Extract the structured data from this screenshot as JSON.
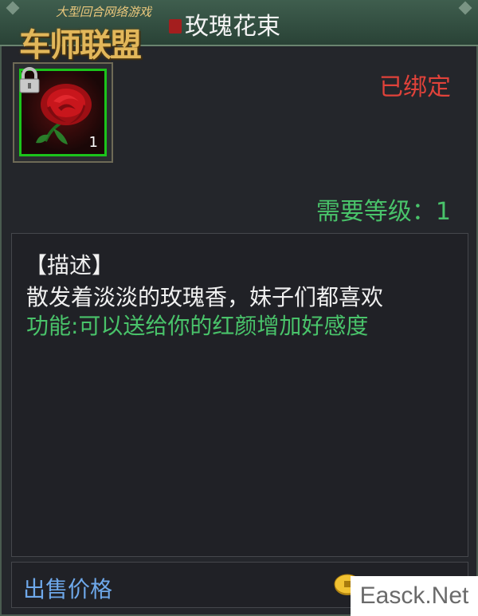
{
  "logo": {
    "tagline": "大型回合网络游戏",
    "name": "车师联盟"
  },
  "item": {
    "name": "玫瑰花束",
    "quantity": "1",
    "status": "已绑定",
    "level_requirement": "需要等级：1",
    "icon": "rose-icon",
    "locked_icon": "lock-icon"
  },
  "description": {
    "heading": "【描述】",
    "text": "散发着淡淡的玫瑰香，妹子们都喜欢",
    "function": "功能:可以送给你的红颜增加好感度"
  },
  "sell": {
    "label": "出售价格",
    "currency_icon": "coin-icon"
  },
  "watermark": "Easck.Net",
  "colors": {
    "bound": "#e0423a",
    "green": "#49c36a",
    "sell_label": "#6ea8ea",
    "slot_border": "#1bc41b"
  }
}
